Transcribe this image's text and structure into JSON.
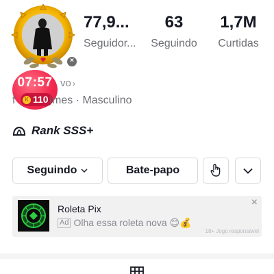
{
  "avatar": {
    "close_symbol": "×"
  },
  "live_timer": {
    "time": "07:57",
    "coins": "110",
    "coin_symbol": "K"
  },
  "stats": [
    {
      "value": "77,9...",
      "label": "Seguidor..."
    },
    {
      "value": "63",
      "label": "Seguindo"
    },
    {
      "value": "1,7M",
      "label": "Curtidas"
    }
  ],
  "bio": {
    "link_text": "vo",
    "link_chevron": "›",
    "meta_partial": "f",
    "meta_text": "imes · Masculino"
  },
  "rank": {
    "label": "Rank SSS+",
    "icon": "rank-cap-icon"
  },
  "actions": {
    "following_label": "Seguindo",
    "chat_label": "Bate-papo",
    "share_icon": "hand-pointer-icon",
    "more_icon": "chevron-down-icon"
  },
  "ad": {
    "title": "Roleta Pix",
    "badge": "Ad",
    "text": "Olha essa roleta nova 😊💰",
    "note": "18+ Jogo responsável",
    "close_symbol": "×"
  },
  "colors": {
    "timer_red": "#f2274d",
    "coin_gold": "#ffc423",
    "text_primary": "#161823",
    "text_secondary": "#6d6e74",
    "ad_bg": "#f1f1f2",
    "roulette_green": "#2ecc40"
  }
}
